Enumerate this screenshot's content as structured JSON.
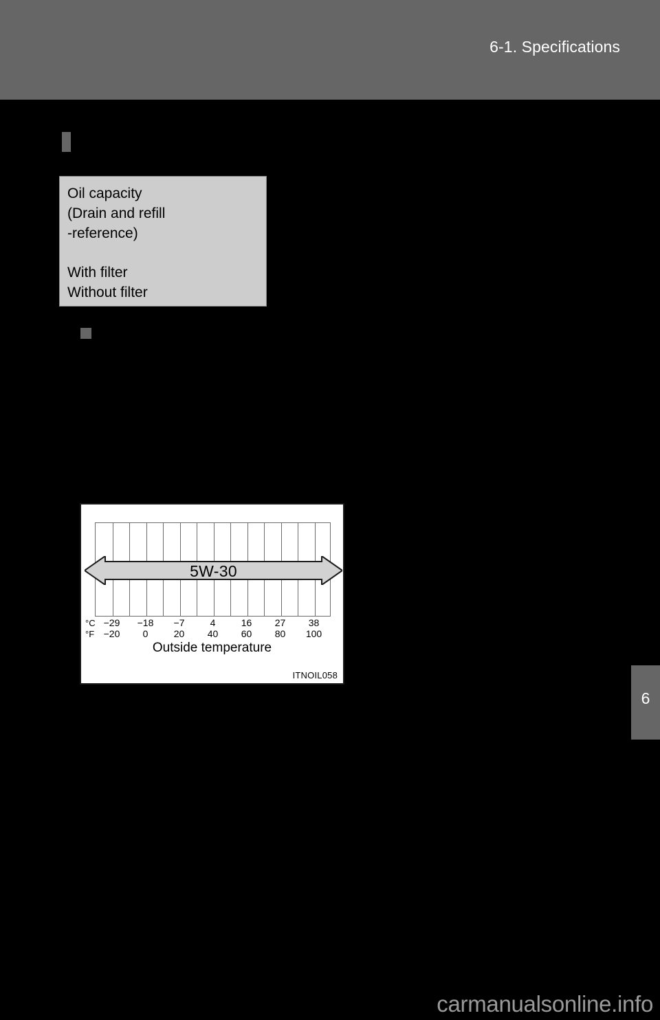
{
  "header": {
    "title": "6-1. Specifications",
    "bar_color": "#666666",
    "text_color": "#ffffff"
  },
  "page_background": "#000000",
  "sections": {
    "oil_capacity": {
      "marker_icon": "square-bullet-icon",
      "box": {
        "background": "#cdcdcd",
        "lines": [
          "Oil capacity",
          "(Drain and refill",
          "-reference)",
          "With filter",
          "Without filter"
        ],
        "line_0": "Oil capacity",
        "line_1": "(Drain and refill",
        "line_2": "-reference)",
        "line_3": "With filter",
        "line_4": "Without filter"
      }
    },
    "oil_type": {
      "marker_icon": "square-bullet-icon"
    }
  },
  "figure": {
    "id_label": "ITNOIL058",
    "caption": "Outside temperature",
    "band_label": "5W-30",
    "unit_celsius": "°C",
    "unit_fahrenheit": "°F"
  },
  "chart_data": {
    "type": "bar",
    "title": "",
    "subtitle": "",
    "xlabel": "Outside temperature",
    "ylabel": "",
    "grid": true,
    "grid_columns": 14,
    "legend_position": "none",
    "annotations": [
      {
        "text": "5W-30",
        "type": "double-headed-arrow-band",
        "x_start": -29,
        "x_end": 38,
        "unit": "°C",
        "spans_full_range": true
      }
    ],
    "axes": [
      {
        "name": "celsius",
        "unit_label": "°C",
        "tick_labels": [
          "−29",
          "−18",
          "−7",
          "4",
          "16",
          "27",
          "38"
        ],
        "tick_values": [
          -29,
          -18,
          -7,
          4,
          16,
          27,
          38
        ],
        "xlim": [
          -29,
          38
        ]
      },
      {
        "name": "fahrenheit",
        "unit_label": "°F",
        "tick_labels": [
          "−20",
          "0",
          "20",
          "40",
          "60",
          "80",
          "100"
        ],
        "tick_values": [
          -20,
          0,
          20,
          40,
          60,
          80,
          100
        ],
        "xlim": [
          -20,
          100
        ]
      }
    ],
    "categories": [
      "−29",
      "−18",
      "−7",
      "4",
      "16",
      "27",
      "38"
    ],
    "values": [
      1,
      1,
      1,
      1,
      1,
      1,
      1
    ],
    "series": [
      {
        "name": "5W-30",
        "x_start_c": -29,
        "x_end_c": 38,
        "x_start_f": -20,
        "x_end_f": 100
      }
    ]
  },
  "chapter_tab": {
    "number": "6"
  },
  "watermark": {
    "text": "carmanualsonline.info"
  }
}
